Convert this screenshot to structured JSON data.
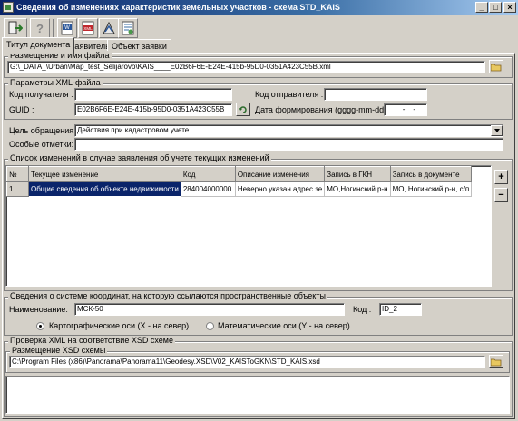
{
  "window": {
    "title": "Сведения об изменениях характеристик земельных участков - схема STD_KAIS"
  },
  "tabs": [
    "Титул документа",
    "Заявитель",
    "Объект заявки"
  ],
  "file_group": {
    "title": "Размещение и имя файла",
    "path": "G:\\_DATA_\\Urban\\Map_test_Selijarovo\\KAIS____E02B6F6E-E24E-415b-95D0-0351A423C55B.xml"
  },
  "xml_group": {
    "title": "Параметры XML-файла",
    "recipient_label": "Код получателя :",
    "recipient_value": "",
    "sender_label": "Код отправителя :",
    "sender_value": "",
    "guid_label": "GUID :",
    "guid_value": "E02B6F6E-E24E-415b-95D0-0351A423C55B",
    "date_label": "Дата формирования (gggg-mm-dd):",
    "date_value": "____-__-__"
  },
  "purpose": {
    "label": "Цель обращения:",
    "value": "Действия при кадастровом учете"
  },
  "notes": {
    "label": "Особые отметки:",
    "value": ""
  },
  "changes": {
    "title": "Список изменений в случае заявления об учете текущих изменений",
    "columns": [
      "№",
      "Текущее изменение",
      "Код",
      "Описание изменения",
      "Запись в ГКН",
      "Запись в документе"
    ],
    "rows": [
      [
        "1",
        "Общие сведения об объекте недвижимости",
        "284004000000",
        "Неверно указан адрес зе",
        "МО,Ногинский р-н",
        "МО, Ногинский р-н, с/п"
      ]
    ]
  },
  "coords": {
    "title": "Сведения о системе координат, на которую ссылаются пространственные объекты",
    "name_label": "Наименование:",
    "name_value": "МСК-50",
    "code_label": "Код :",
    "code_value": "ID_2",
    "radio_carto": "Картографические оси (X - на север)",
    "radio_math": "Математические оси (Y - на север)"
  },
  "xsd": {
    "title": "Проверка XML на соответствие XSD схеме",
    "sub_title": "Размещение XSD схемы",
    "path": "C:\\Program Files (x86)\\Panorama\\Panorama11\\Geodesy.XSD\\V02_KAISToGKN\\STD_KAIS.xsd"
  },
  "toolbar_icons": [
    "exit-icon",
    "help-icon",
    "word-export-icon",
    "xml-export-icon",
    "xml-validate-icon",
    "settings-icon"
  ],
  "colors": {
    "titlebar": "#0a246a",
    "face": "#d4d0c8",
    "selection": "#0a246a"
  }
}
